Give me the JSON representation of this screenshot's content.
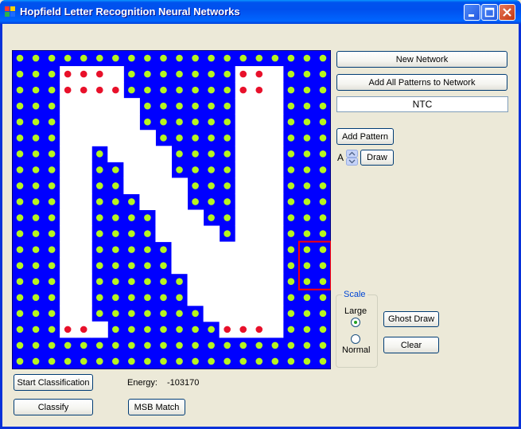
{
  "window": {
    "title": "Hopfield Letter Recognition Neural Networks"
  },
  "buttons": {
    "new_network": "New Network",
    "add_all_patterns": "Add All Patterns to Network",
    "add_pattern": "Add Pattern",
    "draw": "Draw",
    "ghost_draw": "Ghost Draw",
    "clear": "Clear",
    "start_classification": "Start Classification",
    "classify": "Classify",
    "msb_match": "MSB Match"
  },
  "pattern_text": {
    "value": "NTC"
  },
  "letter_select": {
    "value": "A"
  },
  "scale": {
    "title": "Scale",
    "options": [
      "Large",
      "Normal"
    ],
    "selected": "Large"
  },
  "energy": {
    "label": "Energy:",
    "value": "-103170"
  },
  "colors": {
    "background": "#0000ff",
    "active_dot": "#b6f51f",
    "modified_dot": "#e8102a",
    "pattern_white": "#ffffff",
    "highlight": "#ff0000"
  },
  "grid": {
    "cells": 20,
    "white_runs": [
      [],
      [
        [
          3,
          6
        ],
        [
          14,
          16
        ]
      ],
      [
        [
          3,
          6
        ],
        [
          14,
          16
        ]
      ],
      [
        [
          3,
          7
        ],
        [
          14,
          16
        ]
      ],
      [
        [
          3,
          7
        ],
        [
          14,
          16
        ]
      ],
      [
        [
          3,
          8
        ],
        [
          14,
          16
        ]
      ],
      [
        [
          3,
          4
        ],
        [
          6,
          9
        ],
        [
          14,
          16
        ]
      ],
      [
        [
          3,
          4
        ],
        [
          7,
          9
        ],
        [
          14,
          16
        ]
      ],
      [
        [
          3,
          4
        ],
        [
          7,
          10
        ],
        [
          14,
          16
        ]
      ],
      [
        [
          3,
          4
        ],
        [
          8,
          10
        ],
        [
          14,
          16
        ]
      ],
      [
        [
          3,
          4
        ],
        [
          9,
          11
        ],
        [
          14,
          16
        ]
      ],
      [
        [
          3,
          4
        ],
        [
          9,
          12
        ],
        [
          14,
          16
        ]
      ],
      [
        [
          3,
          4
        ],
        [
          10,
          12
        ],
        [
          13,
          16
        ]
      ],
      [
        [
          3,
          4
        ],
        [
          10,
          13
        ],
        [
          13,
          16
        ]
      ],
      [
        [
          3,
          4
        ],
        [
          11,
          16
        ]
      ],
      [
        [
          3,
          4
        ],
        [
          11,
          16
        ]
      ],
      [
        [
          3,
          4
        ],
        [
          12,
          16
        ]
      ],
      [
        [
          3,
          5
        ],
        [
          13,
          16
        ]
      ],
      [],
      []
    ],
    "red_dots": [
      [
        1,
        3
      ],
      [
        1,
        4
      ],
      [
        1,
        5
      ],
      [
        1,
        14
      ],
      [
        1,
        15
      ],
      [
        2,
        3
      ],
      [
        2,
        4
      ],
      [
        2,
        5
      ],
      [
        2,
        6
      ],
      [
        2,
        14
      ],
      [
        2,
        15
      ],
      [
        17,
        3
      ],
      [
        17,
        4
      ],
      [
        17,
        13
      ],
      [
        17,
        14
      ],
      [
        17,
        15
      ]
    ],
    "highlight_box": {
      "row": 12,
      "col": 18,
      "rows": 3,
      "cols": 2
    }
  }
}
